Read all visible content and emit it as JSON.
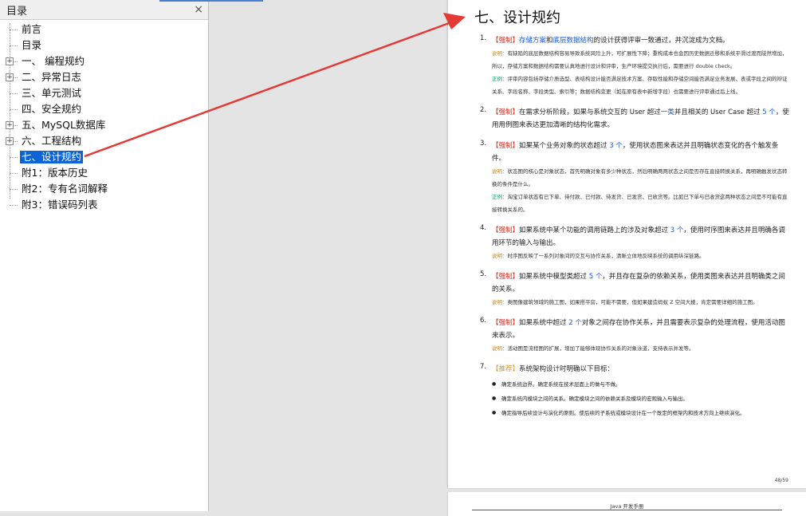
{
  "toc": {
    "title": "目录",
    "close": "×",
    "items": [
      {
        "label": "前言",
        "expandable": false
      },
      {
        "label": "目录",
        "expandable": false
      },
      {
        "label": "一、 编程规约",
        "expandable": true
      },
      {
        "label": "二、异常日志",
        "expandable": true
      },
      {
        "label": "三、单元测试",
        "expandable": false
      },
      {
        "label": "四、安全规约",
        "expandable": false
      },
      {
        "label": "五、MySQL数据库",
        "expandable": true
      },
      {
        "label": "六、工程结构",
        "expandable": true
      },
      {
        "label": "七、设计规约",
        "expandable": false,
        "selected": true
      },
      {
        "label": "附1：版本历史",
        "expandable": false
      },
      {
        "label": "附2：专有名词解释",
        "expandable": false
      },
      {
        "label": "附3：错误码列表",
        "expandable": false
      }
    ]
  },
  "page": {
    "title": "七、设计规约",
    "items": [
      {
        "num": "1.",
        "tag": "【强制】",
        "parts": [
          "存储方案",
          "和",
          "底层数据结构",
          "的设计获得评审一致通过，并沉淀成为文档。"
        ],
        "note": {
          "tag": "说明：",
          "text": "有缺陷的底层数据结构容易导致系统风险上升，可扩展性下降；重构成本也会因历史数据迁移和系统平滑过渡而陡然增加，所以，存储方案和数据结构需要认真地进行设计和评审，生产环境提交执行后，需要进行 double check。"
        },
        "example": {
          "tag": "正例：",
          "text": "评审内容包括存储介质选型、表结构设计能否满足技术方案、存取性能和存储空间能否满足业务发展、表或字段之间的辩证关系、字段名称、字段类型、索引等；数据结构变更（如在原有表中新增字段）也需要进行评审通过后上线。"
        }
      },
      {
        "num": "2.",
        "tag": "【强制】",
        "parts": [
          "在需求分析阶段，如果与系统交互的 User 超过",
          "一类",
          "并且相关的 User Case 超过 ",
          "5 个",
          "，使用用例图来表达更加清晰的结构化需求。"
        ]
      },
      {
        "num": "3.",
        "tag": "【强制】",
        "parts": [
          "如果某个业务对象的状态超过 ",
          "3 个",
          "，使用状态图来表达并且明确状态变化的各个触发条件。"
        ],
        "note": {
          "tag": "说明：",
          "text": "状态图的核心是对象状态，首先明确对象有多少种状态，然后明确两两状态之间是否存在直接转换关系，再明确触发状态转换的条件是什么。"
        },
        "example": {
          "tag": "正例：",
          "text": "淘宝订单状态有已下单、待付款、已付款、待发货、已发货、已收货等。比如已下单与已收货这两种状态之间是不可能有直接转换关系的。"
        }
      },
      {
        "num": "4.",
        "tag": "【强制】",
        "parts": [
          "如果系统中某个功能的调用链路上的涉及对象超过 ",
          "3 个",
          "，使用时序图来表达并且明确各调用环节的输入与输出。"
        ],
        "note": {
          "tag": "说明：",
          "text": "时序图反映了一系列对象间的交互与协作关系，清晰立体地反映系统的调用纵深链路。"
        }
      },
      {
        "num": "5.",
        "tag": "【强制】",
        "parts": [
          "如果系统中模型类超过 ",
          "5 个",
          "，并且存在复杂的依赖关系，使用类图来表达并且明确类之间的关系。"
        ],
        "note": {
          "tag": "说明：",
          "text": "类图像建筑领域的施工图，如果搭平房，可能不需要，但如果建造蚂蚁 Z 空间大楼，肯定需要详细的施工图。"
        }
      },
      {
        "num": "6.",
        "tag": "【强制】",
        "parts": [
          "如果系统中超过 ",
          "2 个",
          "对象之间存在协作关系，并且需要表示复杂的处理流程，使用活动图来表示。"
        ],
        "note": {
          "tag": "说明：",
          "text": "活动图是流程图的扩展，增加了能够体现协作关系的对象泳道，支持表示并发等。"
        }
      },
      {
        "num": "7.",
        "tag": "【推荐】",
        "parts": [
          "系统架构设计时明确以下目标："
        ],
        "bullets": [
          "确定系统边界。确定系统在技术层面上的做与不做。",
          "确定系统内模块之间的关系。确定模块之间的依赖关系及模块的宏观输入与输出。",
          "确定指导后续设计与演化的原则。使后续的子系统或模块设计在一个既定的框架内和技术方向上继续演化。"
        ]
      }
    ],
    "page_number": "48/59"
  },
  "next_page": {
    "header": "Java 开发手册"
  },
  "colors": {
    "selected_bg": "#0a64d6",
    "arrow": "#e53935",
    "strong_tag": "#d4311f",
    "recommend_tag": "#d89a2c",
    "highlight": "#1a59d6",
    "note_tag": "#c08a2a",
    "example_tag": "#1a9b63"
  }
}
